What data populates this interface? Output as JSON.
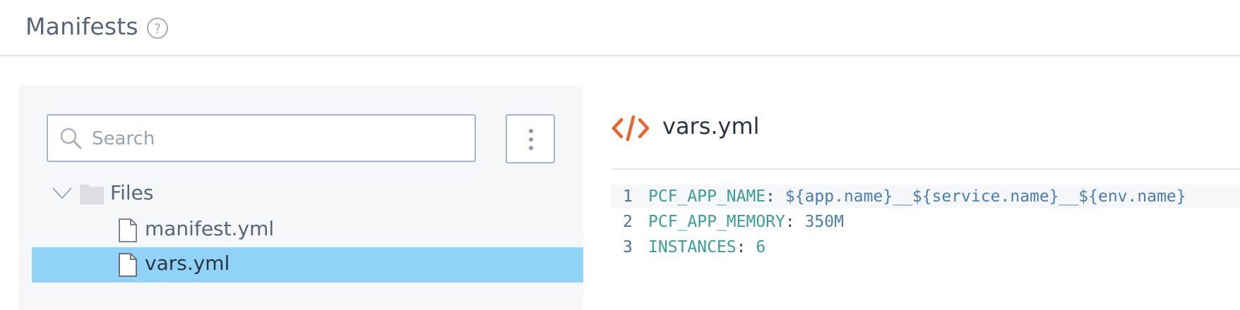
{
  "header": {
    "title": "Manifests",
    "help_icon": "question-circle-icon"
  },
  "search": {
    "placeholder": "Search",
    "value": ""
  },
  "more_menu_icon": "vertical-ellipsis-icon",
  "tree": {
    "folder": {
      "label": "Files",
      "expanded": true,
      "icon": "folder-icon"
    },
    "files": [
      {
        "label": "manifest.yml",
        "selected": false,
        "icon": "file-icon"
      },
      {
        "label": "vars.yml",
        "selected": true,
        "icon": "file-icon"
      }
    ]
  },
  "editor": {
    "filename": "vars.yml",
    "icon": "code-brackets-icon",
    "lines": [
      {
        "number": "1",
        "key": "PCF_APP_NAME",
        "value": "${app.name}__${service.name}__${env.name}"
      },
      {
        "number": "2",
        "key": "PCF_APP_MEMORY",
        "value": "350M"
      },
      {
        "number": "3",
        "key": "INSTANCES",
        "value": "6"
      }
    ]
  },
  "colors": {
    "selection": "#91d3f6",
    "accent_code_icon": "#f0602a",
    "yaml_key": "#3a9e9a",
    "yaml_value": "#4a7db3"
  }
}
